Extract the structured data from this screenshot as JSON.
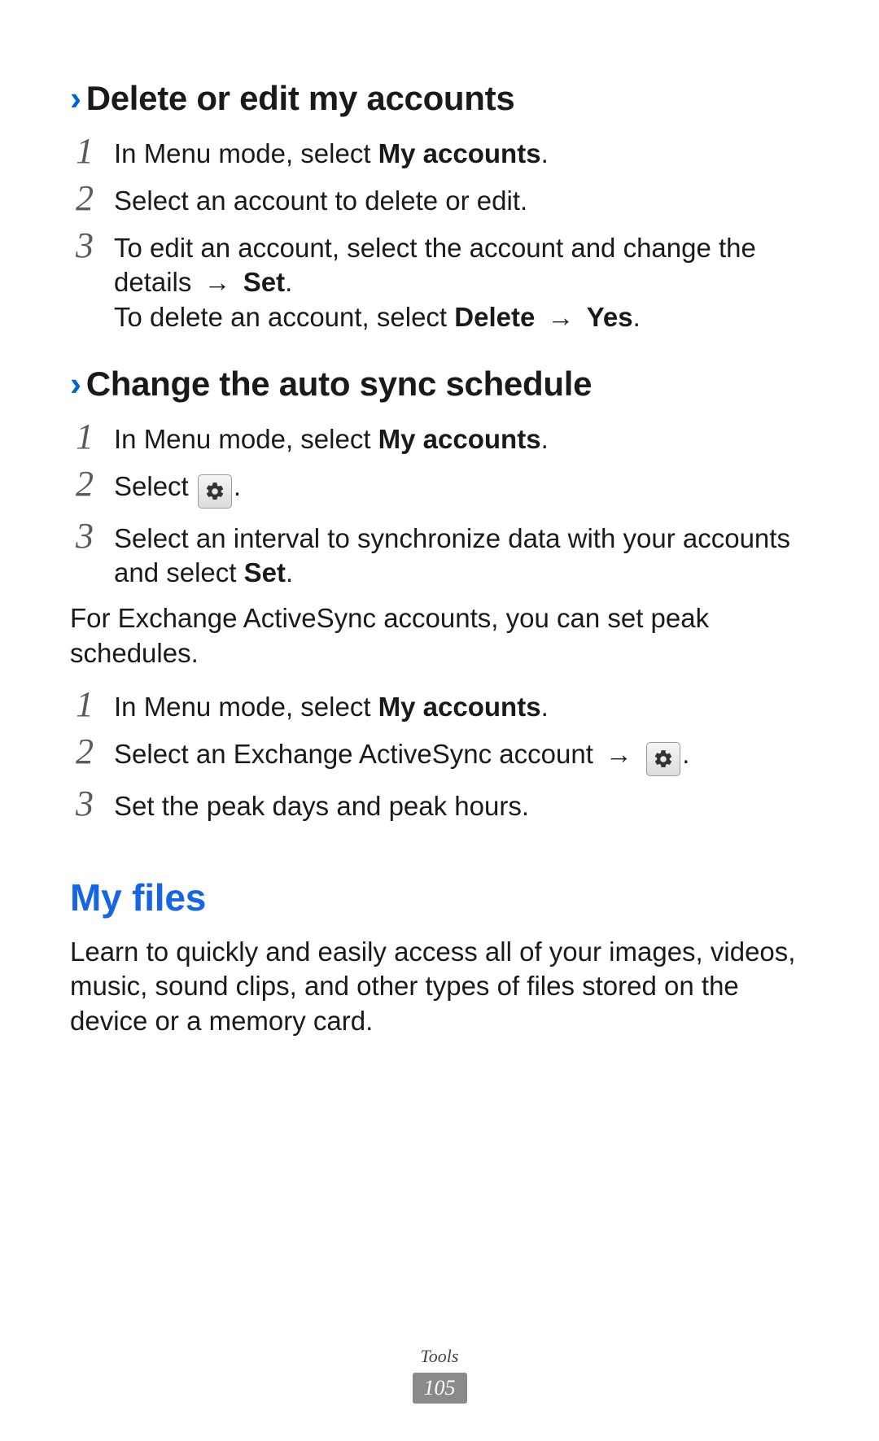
{
  "section1": {
    "heading": "Delete or edit my accounts",
    "steps": {
      "s1_pre": "In Menu mode, select ",
      "s1_bold": "My accounts",
      "s1_post": ".",
      "s2": "Select an account to delete or edit.",
      "s3_a_pre": "To edit an account, select the account and change the details ",
      "s3_a_bold": "Set",
      "s3_a_post": ".",
      "s3_b_pre": "To delete an account, select ",
      "s3_b_bold1": "Delete",
      "s3_b_bold2": "Yes",
      "s3_b_post": "."
    }
  },
  "section2": {
    "heading": "Change the auto sync schedule",
    "steps": {
      "s1_pre": "In Menu mode, select ",
      "s1_bold": "My accounts",
      "s1_post": ".",
      "s2_pre": "Select ",
      "s2_post": ".",
      "s3_pre": "Select an interval to synchronize data with your accounts and select ",
      "s3_bold": "Set",
      "s3_post": "."
    },
    "note": "For Exchange ActiveSync accounts, you can set peak schedules.",
    "steps2": {
      "s1_pre": "In Menu mode, select ",
      "s1_bold": "My accounts",
      "s1_post": ".",
      "s2_pre": "Select an Exchange ActiveSync account ",
      "s2_post": ".",
      "s3": "Set the peak days and peak hours."
    }
  },
  "section3": {
    "heading": "My files",
    "text": "Learn to quickly and easily access all of your images, videos, music, sound clips, and other types of files stored on the device or a memory card."
  },
  "footer": {
    "category": "Tools",
    "page": "105"
  },
  "glyphs": {
    "arrow": "→"
  }
}
